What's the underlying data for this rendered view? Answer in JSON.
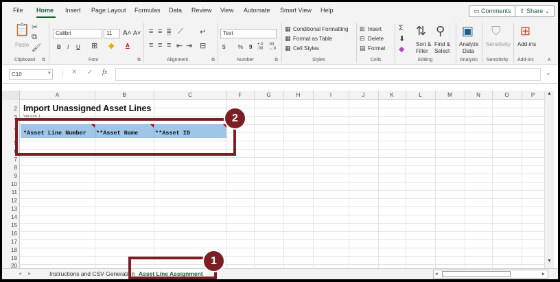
{
  "menu": {
    "items": [
      "File",
      "Home",
      "Insert",
      "Page Layout",
      "Formulas",
      "Data",
      "Review",
      "View",
      "Automate",
      "Smart View",
      "Help"
    ],
    "comments_label": "Comments",
    "share_label": "Share"
  },
  "ribbon": {
    "clipboard": {
      "paste_label": "Paste",
      "group_label": "Clipboard"
    },
    "font": {
      "font_name": "Calibri",
      "font_size": "11",
      "bold": "B",
      "italic": "I",
      "underline": "U",
      "group_label": "Font"
    },
    "alignment": {
      "group_label": "Alignment"
    },
    "number": {
      "format": "Text",
      "currency": "$",
      "percent": "%",
      "comma": "9",
      "inc_decimal": "+.0 .00",
      "dec_decimal": ".00 →.0",
      "group_label": "Number"
    },
    "styles": {
      "conditional_formatting": "Conditional Formatting",
      "format_as_table": "Format as Table",
      "cell_styles": "Cell Styles",
      "group_label": "Styles"
    },
    "cells": {
      "insert": "Insert",
      "delete": "Delete",
      "format": "Format",
      "group_label": "Cells"
    },
    "editing": {
      "sort_filter_1": "Sort &",
      "sort_filter_2": "Filter",
      "find_select_1": "Find &",
      "find_select_2": "Select",
      "group_label": "Editing"
    },
    "analysis": {
      "analyze_1": "Analyze",
      "analyze_2": "Data",
      "group_label": "Analysis"
    },
    "sensitivity": {
      "label": "Sensitivity",
      "group_label": "Sensitivity"
    },
    "addins": {
      "label": "Add-ins",
      "group_label": "Add-ins"
    }
  },
  "formula_bar": {
    "cell_ref": "C10",
    "fx": "fx",
    "content": ""
  },
  "columns": [
    "A",
    "B",
    "C",
    "F",
    "G",
    "H",
    "I",
    "J",
    "K",
    "L",
    "M",
    "N",
    "O",
    "P"
  ],
  "rows": [
    "2",
    "3",
    "4",
    "5",
    "6",
    "7",
    "8",
    "9",
    "10",
    "11",
    "12",
    "13",
    "14",
    "15",
    "16",
    "17",
    "18",
    "19",
    "20"
  ],
  "sheet": {
    "title": "Import Unassigned Asset Lines",
    "subtitle": "Version 1",
    "headers": [
      "*Asset Line Number",
      "**Asset Name",
      "**Asset ID"
    ]
  },
  "tabs": {
    "items": [
      "Instructions and CSV Generation",
      "Asset Line Assignment"
    ],
    "active": "Asset Line Assignment"
  },
  "annotations": {
    "badge1": "1",
    "badge2": "2",
    "color": "#7b1f24"
  },
  "colors": {
    "accent": "#185c37",
    "header_fill": "#9fc5e8",
    "note_marker": "#c00000"
  }
}
